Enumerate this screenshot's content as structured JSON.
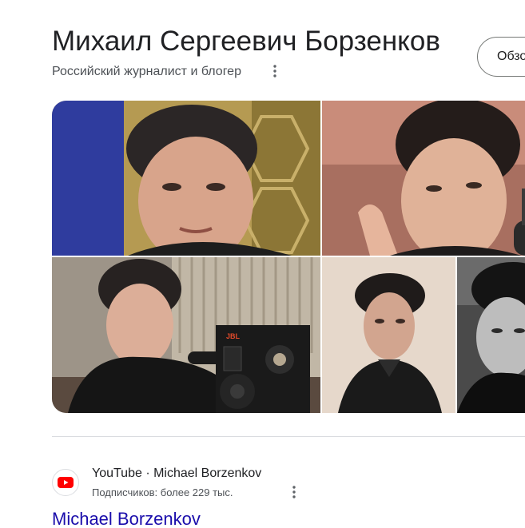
{
  "header": {
    "title": "Михаил Сергеевич Борзенков",
    "subtitle": "Российский журналист и блогер",
    "overview_button": "Обзор"
  },
  "gallery": {
    "photos": [
      {
        "name": "photo-portrait-gold-background"
      },
      {
        "name": "photo-speaking-at-microphone"
      },
      {
        "name": "photo-with-jbl-speaker"
      },
      {
        "name": "photo-studio-portrait"
      },
      {
        "name": "photo-black-and-white"
      }
    ],
    "speaker_brand": "JBL"
  },
  "result": {
    "source_name": "YouTube · Michael Borzenkov",
    "source_subtitle": "Подписчиков: более 229 тыс.",
    "link_title": "Michael Borzenkov"
  },
  "colors": {
    "link": "#1a0dab",
    "youtube_red": "#ff0000",
    "divider": "#dadce0"
  }
}
